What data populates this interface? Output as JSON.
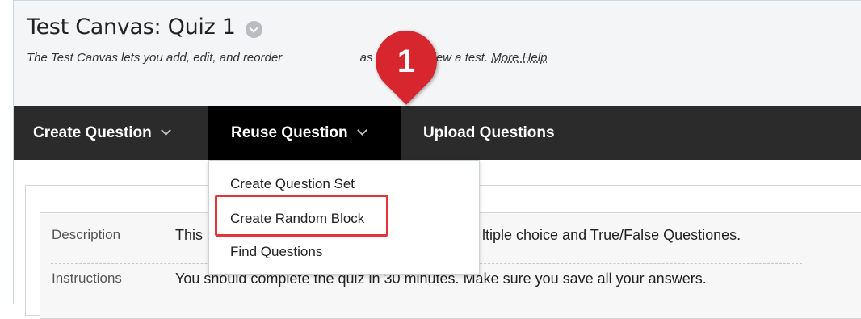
{
  "header": {
    "title": "Test Canvas: Quiz 1",
    "description_text": "The Test Canvas lets you add, edit, and reorder",
    "description_tail": "as well as review a test.",
    "more_help_link": "More Help",
    "title_menu_icon": "chevron-down-circle-icon"
  },
  "toolbar": {
    "items": [
      {
        "label": "Create Question",
        "icon": "chevron-down-icon"
      },
      {
        "label": "Reuse Question",
        "icon": "chevron-down-icon",
        "active": true
      },
      {
        "label": "Upload Questions"
      }
    ]
  },
  "dropdown": {
    "items": [
      {
        "label": "Create Question Set"
      },
      {
        "label": "Create Random Block",
        "highlighted": true
      },
      {
        "label": "Find Questions"
      }
    ]
  },
  "details": {
    "rows": [
      {
        "label": "Description",
        "value_start": "This",
        "value_end": "ltiple choice and True/False Questiones."
      },
      {
        "label": "Instructions",
        "value": "You should complete the quiz in 30 minutes. Make sure you save all your answers."
      }
    ]
  },
  "annotation": {
    "step_number": "1",
    "highlight_color": "#e2353b",
    "callout_color": "#d7262d"
  }
}
